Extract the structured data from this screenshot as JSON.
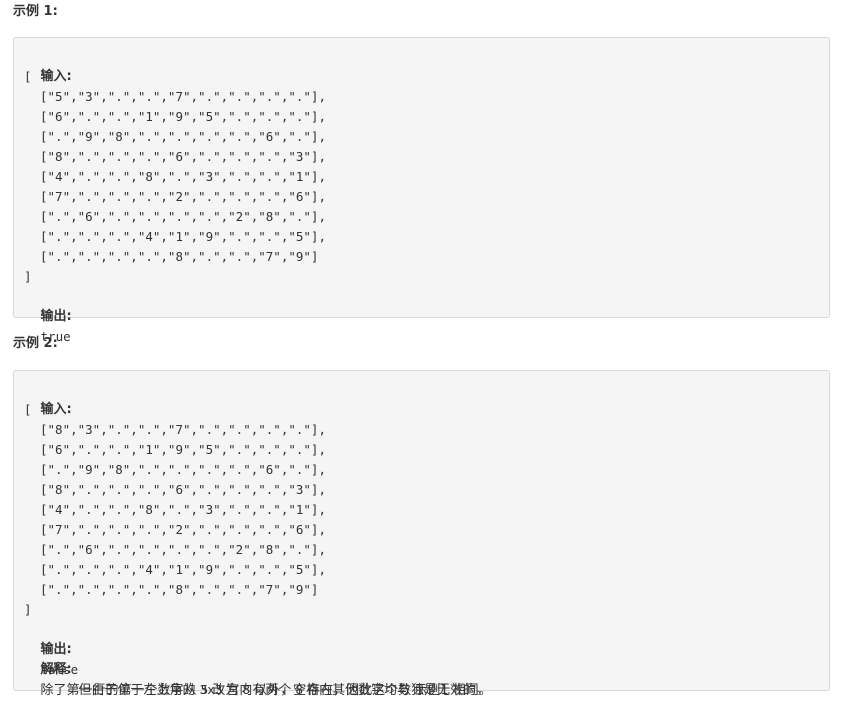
{
  "example1": {
    "heading": "示例 1:",
    "input_label": "输入:",
    "open_bracket": "[",
    "rows": [
      "[\"5\",\"3\",\".\",\".\",\"7\",\".\",\".\",\".\",\".\"],",
      "[\"6\",\".\",\".\",\"1\",\"9\",\"5\",\".\",\".\",\".\"],",
      "[\".\",\"9\",\"8\",\".\",\".\",\".\",\".\",\"6\",\".\"],",
      "[\"8\",\".\",\".\",\".\",\"6\",\".\",\".\",\".\",\"3\"],",
      "[\"4\",\".\",\".\",\"8\",\".\",\"3\",\".\",\".\",\"1\"],",
      "[\"7\",\".\",\".\",\".\",\"2\",\".\",\".\",\".\",\"6\"],",
      "[\".\",\"6\",\".\",\".\",\".\",\".\",\"2\",\"8\",\".\"],",
      "[\".\",\".\",\".\",\"4\",\"1\",\"9\",\".\",\".\",\"5\"],",
      "[\".\",\".\",\".\",\".\",\"8\",\".\",\".\",\"7\",\"9\"]"
    ],
    "close_bracket": "]",
    "output_label": "输出:",
    "output_value": "true"
  },
  "example2": {
    "heading": "示例 2:",
    "input_label": "输入:",
    "open_bracket": "[",
    "rows": [
      "[\"8\",\"3\",\".\",\".\",\"7\",\".\",\".\",\".\",\".\"],",
      "[\"6\",\".\",\".\",\"1\",\"9\",\"5\",\".\",\".\",\".\"],",
      "[\".\",\"9\",\"8\",\".\",\".\",\".\",\".\",\"6\",\".\"],",
      "[\"8\",\".\",\".\",\".\",\"6\",\".\",\".\",\".\",\"3\"],",
      "[\"4\",\".\",\".\",\"8\",\".\",\"3\",\".\",\".\",\"1\"],",
      "[\"7\",\".\",\".\",\".\",\"2\",\".\",\".\",\".\",\"6\"],",
      "[\".\",\"6\",\".\",\".\",\".\",\".\",\"2\",\"8\",\".\"],",
      "[\".\",\".\",\".\",\"4\",\"1\",\"9\",\".\",\".\",\"5\"],",
      "[\".\",\".\",\".\",\".\",\"8\",\".\",\".\",\"7\",\"9\"]"
    ],
    "close_bracket": "]",
    "output_label": "输出:",
    "output_value": "false",
    "explain_label": "解释:",
    "explain_line1": {
      "t1": "除了第一行的第一个数字从 ",
      "c1": "5",
      "t2": " 改为 ",
      "c2": "8",
      "t3": " 以外，空格内其他数字均与 示例1 相同。"
    },
    "explain_line2": {
      "t1": "但由于位于左上角的 ",
      "c1": "3x3",
      "t2": " 宫内有两个 ",
      "c2": "8",
      "t3": " 存在，因此这个数独是无效的。"
    }
  }
}
